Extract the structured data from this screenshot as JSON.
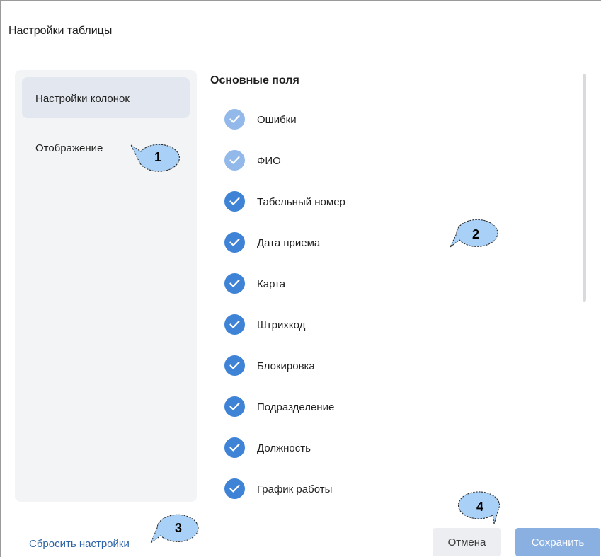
{
  "dialog": {
    "title": "Настройки таблицы"
  },
  "sidebar": {
    "items": [
      {
        "label": "Настройки колонок",
        "active": true
      },
      {
        "label": "Отображение",
        "active": false
      }
    ]
  },
  "main": {
    "section_title": "Основные поля",
    "fields": [
      {
        "label": "Ошибки",
        "checked": true,
        "disabled": true
      },
      {
        "label": "ФИО",
        "checked": true,
        "disabled": true
      },
      {
        "label": "Табельный номер",
        "checked": true,
        "disabled": false
      },
      {
        "label": "Дата приема",
        "checked": true,
        "disabled": false
      },
      {
        "label": "Карта",
        "checked": true,
        "disabled": false
      },
      {
        "label": "Штрихкод",
        "checked": true,
        "disabled": false
      },
      {
        "label": "Блокировка",
        "checked": true,
        "disabled": false
      },
      {
        "label": "Подразделение",
        "checked": true,
        "disabled": false
      },
      {
        "label": "Должность",
        "checked": true,
        "disabled": false
      },
      {
        "label": "График работы",
        "checked": true,
        "disabled": false
      }
    ]
  },
  "footer": {
    "reset_label": "Сбросить настройки",
    "cancel_label": "Отмена",
    "save_label": "Сохранить"
  },
  "callouts": [
    "1",
    "2",
    "3",
    "4"
  ],
  "colors": {
    "checkbox_checked": "#3f83d6",
    "checkbox_disabled": "#92b9e9",
    "link": "#2c63a8",
    "save_button": "#8ab0e2",
    "callout_fill": "#a9d1f7"
  }
}
